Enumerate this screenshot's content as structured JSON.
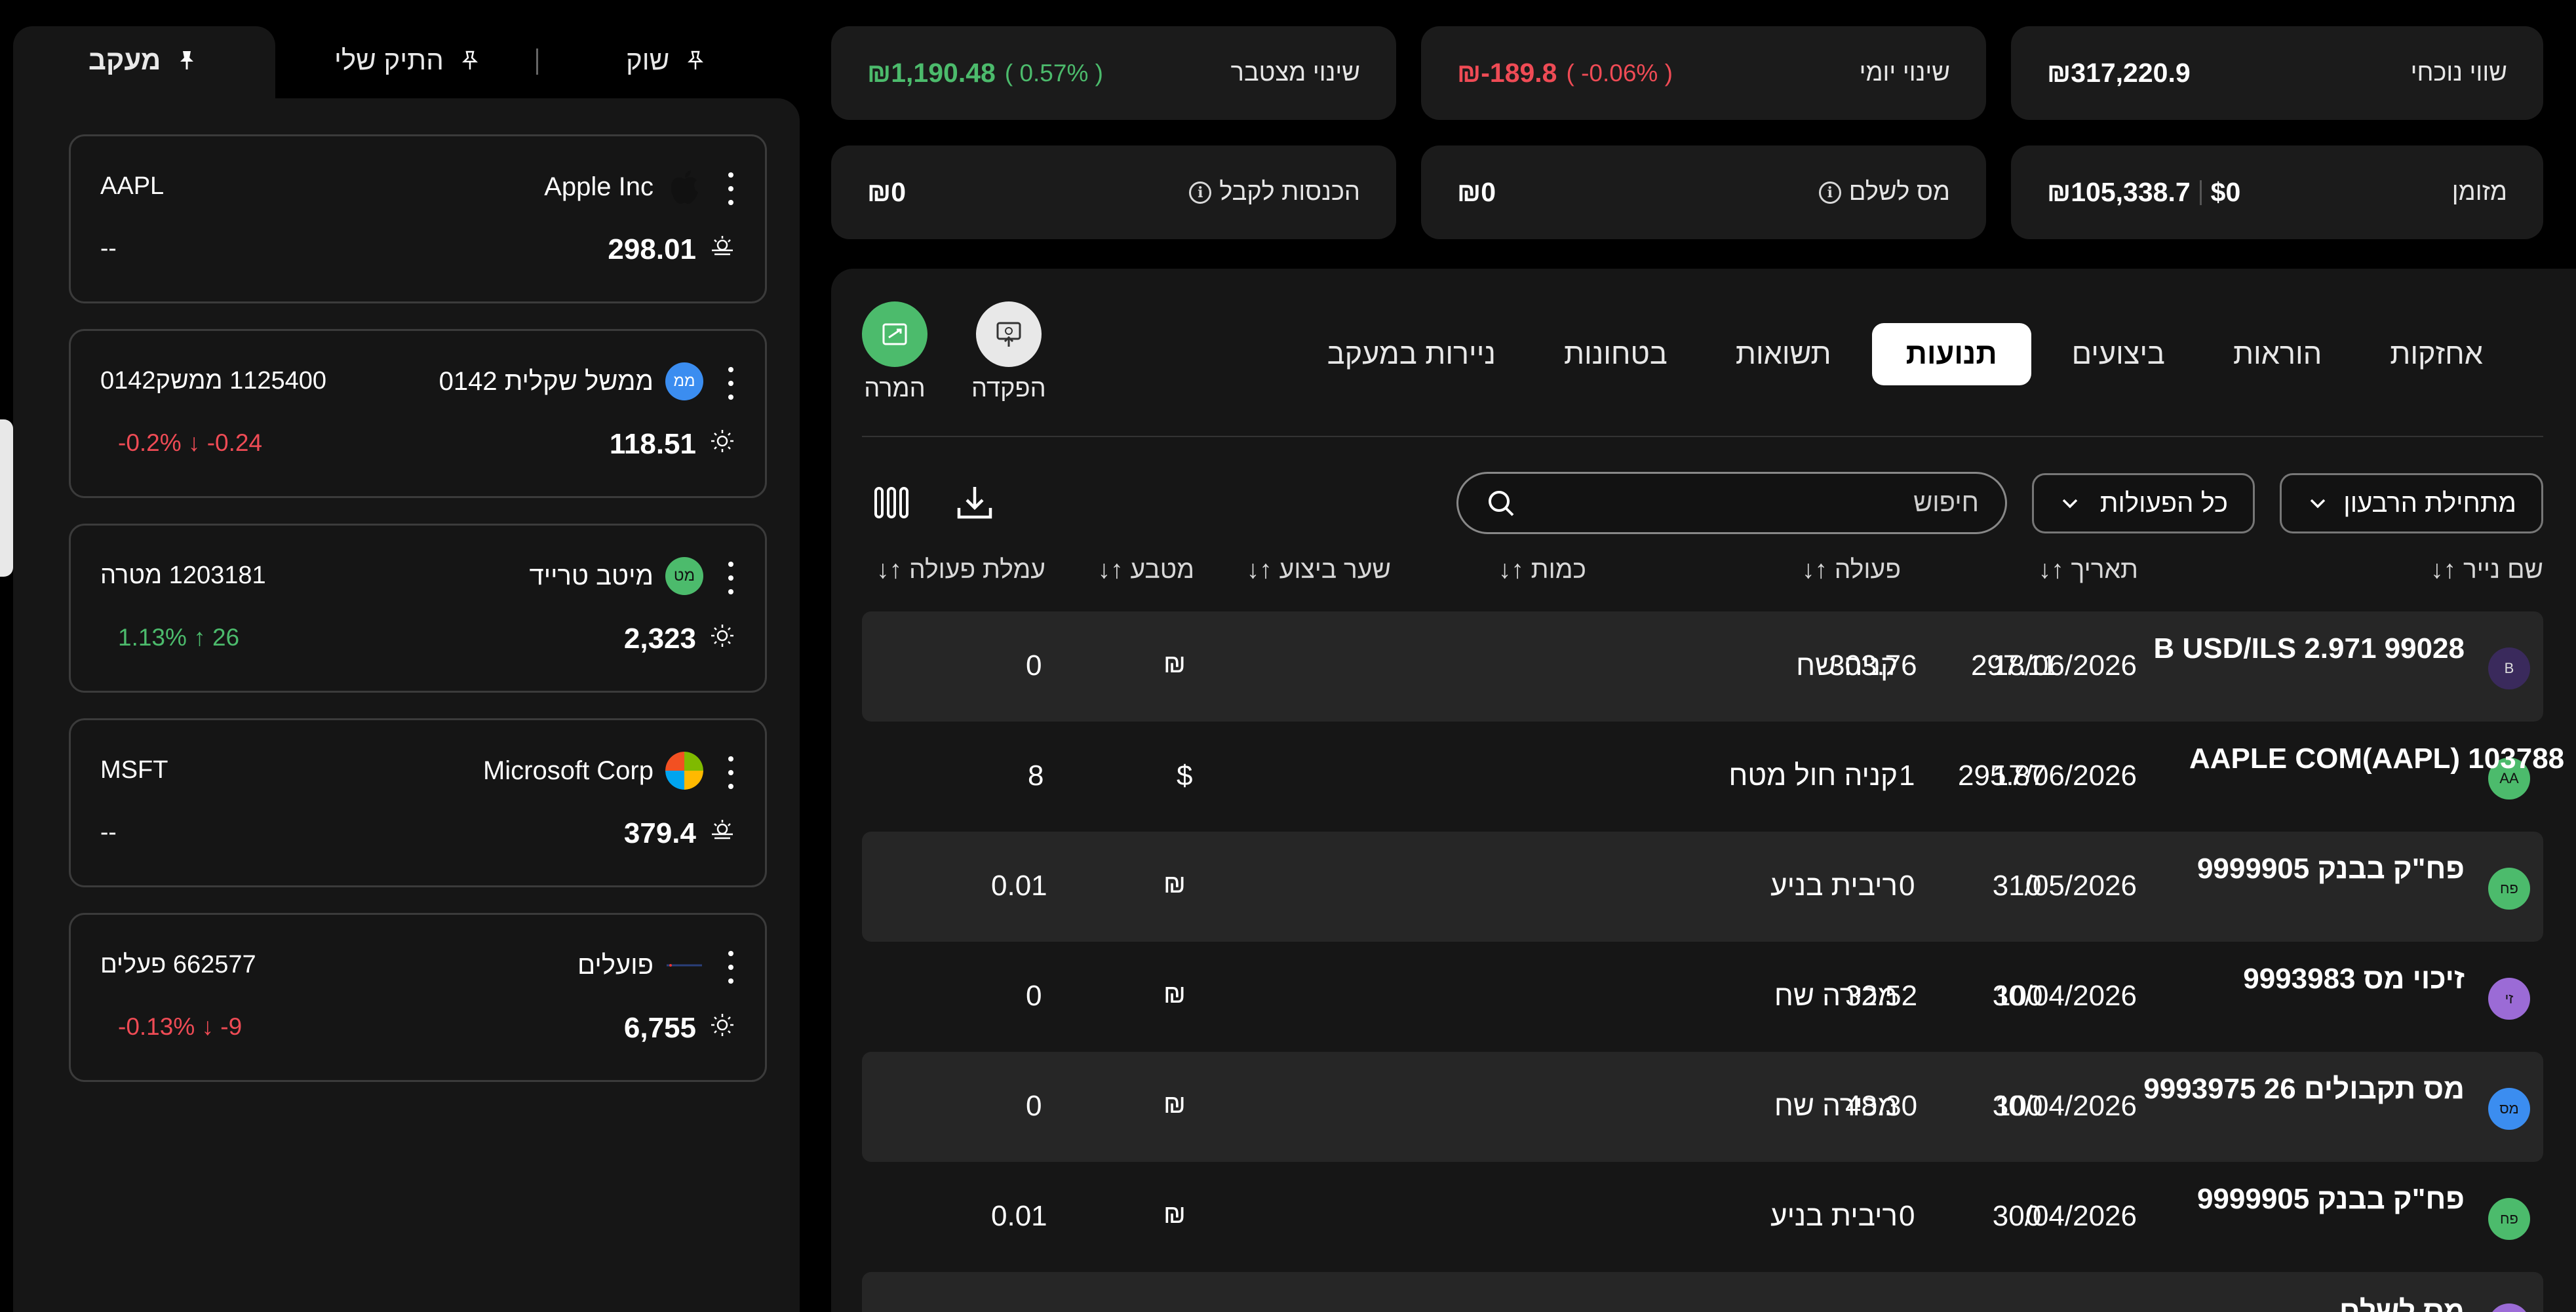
{
  "summary": {
    "current_value": {
      "label": "שווי נוכחי",
      "value": "₪317,220.9"
    },
    "daily_change": {
      "label": "שינוי יומי",
      "value": "₪-189.8",
      "pct": "( -0.06% )"
    },
    "total_change": {
      "label": "שינוי מצטבר",
      "value": "₪1,190.48",
      "pct": "( 0.57% )"
    },
    "cash": {
      "label": "מזומן",
      "usd": "$0",
      "ils": "₪105,338.7"
    },
    "tax_to_pay": {
      "label": "מס לשלם",
      "value": "₪0"
    },
    "income_to_receive": {
      "label": "הכנסות לקבל",
      "value": "₪0"
    }
  },
  "tabs": [
    {
      "label": "אחזקות",
      "active": false
    },
    {
      "label": "הוראות",
      "active": false
    },
    {
      "label": "ביצועים",
      "active": false
    },
    {
      "label": "תנועות",
      "active": true
    },
    {
      "label": "תשואות",
      "active": false
    },
    {
      "label": "בטחונות",
      "active": false
    },
    {
      "label": "ניירות במעקב",
      "active": false
    }
  ],
  "actions": {
    "deposit": "הפקדה",
    "convert": "המרה"
  },
  "filters": {
    "period": "מתחילת הרבעון",
    "action_type": "כל הפעולות",
    "search_placeholder": "חיפוש"
  },
  "table": {
    "headers": {
      "name": "שם נייר ↑↓",
      "date": "תאריך ↑↓",
      "action": "פעולה ↑↓",
      "qty": "כמות ↑↓",
      "price": "שער ביצוע ↑↓",
      "currency": "מטבע ↑↓",
      "fee": "עמלת פעולה ↑↓"
    },
    "rows": [
      {
        "avatar": "B",
        "avatar_color": "#3a2a5c",
        "name": "B USD/ILS 2.971 99028",
        "date": "18/06/2026",
        "action": "קניה שח",
        "qty": "303.76",
        "price": "297.11",
        "currency": "₪",
        "fee": "0"
      },
      {
        "avatar": "AA",
        "avatar_color": "#4cbb6c",
        "name": "AAPLE COM(AAPL) 103788",
        "date": "17/06/2026",
        "action": "קניה חול מטח",
        "qty": "1",
        "price": "295.87",
        "currency": "$",
        "fee": "8"
      },
      {
        "avatar": "פח",
        "avatar_color": "#4cbb6c",
        "name": "פח\"ק בבנק 9999905",
        "date": "31/05/2026",
        "action": "ריבית בניע",
        "qty": "0",
        "price": "0",
        "currency": "₪",
        "fee": "0.01"
      },
      {
        "avatar": "זי",
        "avatar_color": "#9b6bd6",
        "name": "זיכוי מס 9993983",
        "date": "30/04/2026",
        "action": "מכירה שח",
        "qty": "32.52",
        "price": "100",
        "currency": "₪",
        "fee": "0"
      },
      {
        "avatar": "מס",
        "avatar_color": "#3b8df0",
        "name": "מס תקבולים 26 9993975",
        "date": "30/04/2026",
        "action": "מכירה שח",
        "qty": "48.30",
        "price": "100",
        "currency": "₪",
        "fee": "0"
      },
      {
        "avatar": "פח",
        "avatar_color": "#4cbb6c",
        "name": "פח\"ק בבנק 9999905",
        "date": "30/04/2026",
        "action": "ריבית בניע",
        "qty": "0",
        "price": "0",
        "currency": "₪",
        "fee": "0.01"
      },
      {
        "avatar": "",
        "avatar_color": "#9b6bd6",
        "name": "מס לשלם",
        "date": "",
        "action": "",
        "qty": "",
        "price": "",
        "currency": "",
        "fee": ""
      }
    ]
  },
  "left_tabs": [
    {
      "label": "מעקב",
      "active": true
    },
    {
      "label": "התיק שלי",
      "active": false
    },
    {
      "label": "שוק",
      "active": false
    }
  ],
  "watchlist": [
    {
      "name": "Apple Inc",
      "symbol": "AAPL",
      "price": "298.01",
      "change": "--",
      "dir": "none",
      "logo": "apple",
      "sun": "set"
    },
    {
      "name": "ממשל שקלית 0142",
      "symbol": "1125400 ממשק0142",
      "price": "118.51",
      "change": "-0.2% ↓ -0.24",
      "dir": "neg",
      "logo": "ממ",
      "sun": "sun"
    },
    {
      "name": "מיטב טרייד",
      "symbol": "1203181 מטרה",
      "price": "2,323",
      "change": "1.13% ↑ 26",
      "dir": "pos",
      "logo": "מט",
      "sun": "sun"
    },
    {
      "name": "Microsoft Corp",
      "symbol": "MSFT",
      "price": "379.4",
      "change": "--",
      "dir": "none",
      "logo": "ms",
      "sun": "set"
    },
    {
      "name": "פועלים",
      "symbol": "662577 פעלים",
      "price": "6,755",
      "change": "-0.13% ↓ -9",
      "dir": "neg",
      "logo": "poalim",
      "sun": "sun"
    }
  ]
}
